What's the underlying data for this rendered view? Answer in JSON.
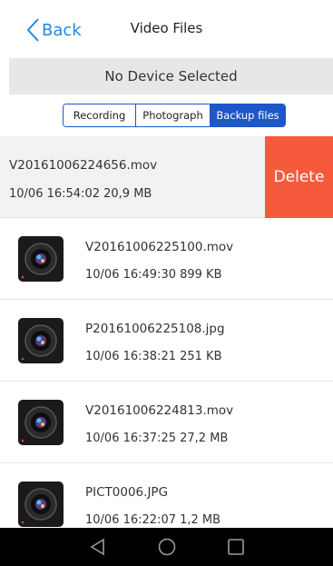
{
  "header": {
    "back_label": "Back",
    "title": "Video Files"
  },
  "device_status": "No Device Selected",
  "tabs": [
    {
      "label": "Recording",
      "active": false
    },
    {
      "label": "Photograph",
      "active": false
    },
    {
      "label": "Backup files",
      "active": true
    }
  ],
  "files": [
    {
      "name": "V20161006224656.mov",
      "meta": "10/06 16:54:02  20,9 MB",
      "action": "Delete"
    },
    {
      "name": "V20161006225100.mov",
      "meta": "10/06 16:49:30  899 KB"
    },
    {
      "name": "P20161006225108.jpg",
      "meta": "10/06 16:38:21  251 KB"
    },
    {
      "name": "V20161006224813.mov",
      "meta": "10/06 16:37:25  27,2 MB"
    },
    {
      "name": "PICT0006.JPG",
      "meta": "10/06 16:22:07  1,2 MB"
    }
  ],
  "colors": {
    "accent": "#1e57c8",
    "back_link": "#1e88e5",
    "delete": "#f55a3d",
    "device_bar": "#e7e7e7",
    "nav_bar": "#000000"
  },
  "icons": {
    "back": "chevron-left-icon",
    "thumbnail": "camera-lens-icon",
    "nav": [
      "back-triangle-icon",
      "home-circle-icon",
      "recents-square-icon"
    ]
  }
}
